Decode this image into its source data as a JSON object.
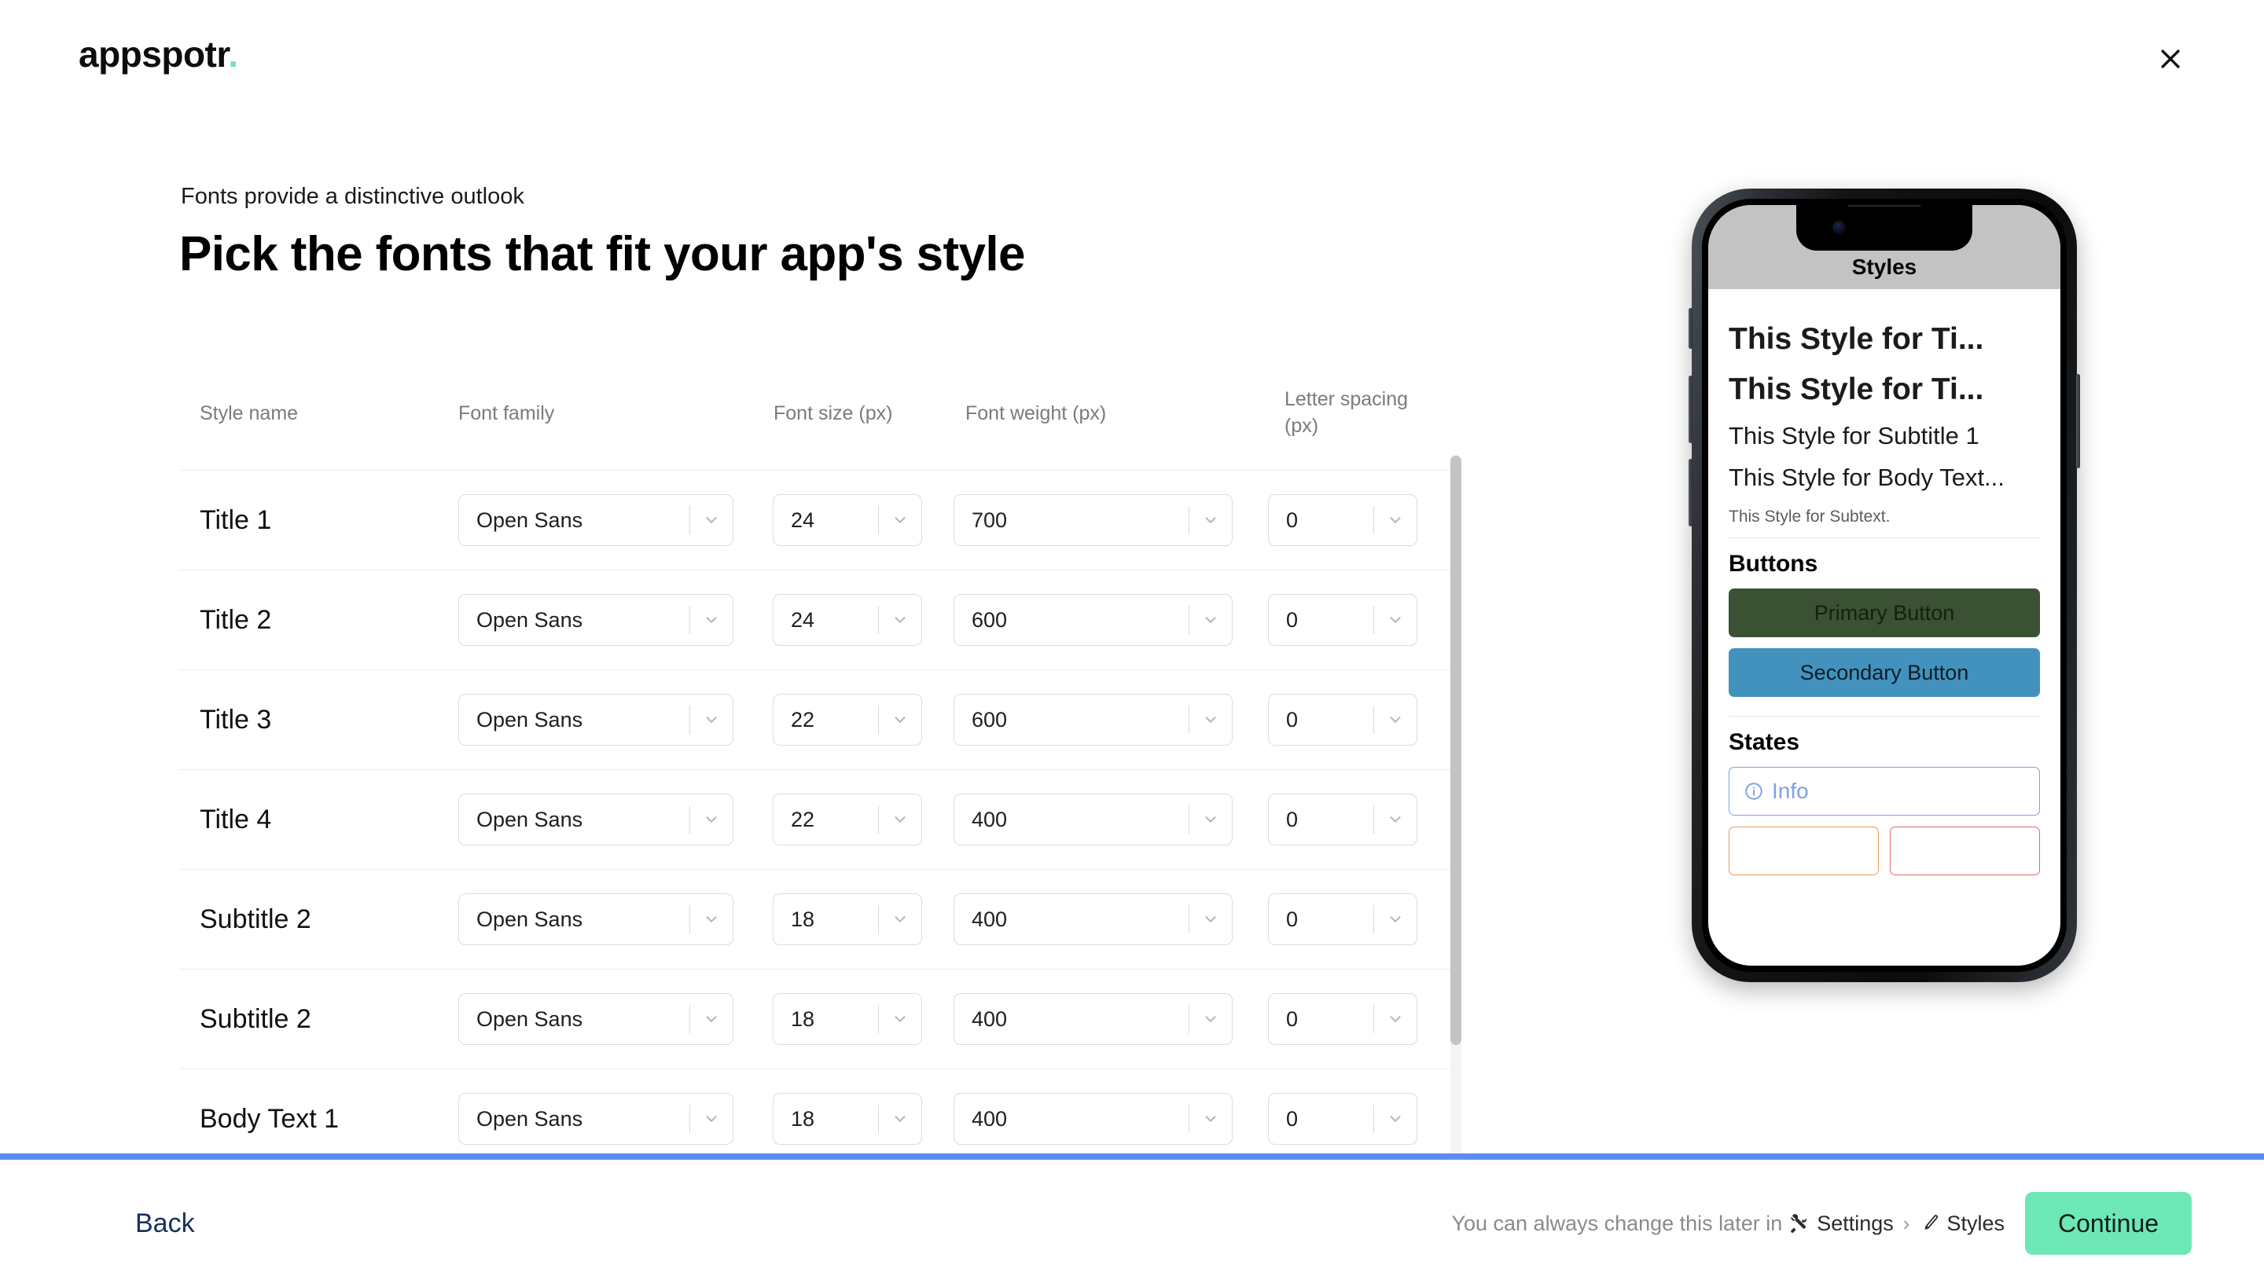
{
  "brand": {
    "name": "appspotr",
    "dot": "."
  },
  "topbar": {
    "close_icon": "close-icon"
  },
  "header": {
    "eyebrow": "Fonts provide a distinctive outlook",
    "title": "Pick the fonts that fit your app's style"
  },
  "table": {
    "columns": [
      "Style name",
      "Font family",
      "Font size (px)",
      "Font weight (px)",
      "Letter spacing (px)"
    ],
    "rows": [
      {
        "style": "Title 1",
        "family": "Open Sans",
        "size": "24",
        "weight": "700",
        "spacing": "0"
      },
      {
        "style": "Title 2",
        "family": "Open Sans",
        "size": "24",
        "weight": "600",
        "spacing": "0"
      },
      {
        "style": "Title 3",
        "family": "Open Sans",
        "size": "22",
        "weight": "600",
        "spacing": "0"
      },
      {
        "style": "Title 4",
        "family": "Open Sans",
        "size": "22",
        "weight": "400",
        "spacing": "0"
      },
      {
        "style": "Subtitle 2",
        "family": "Open Sans",
        "size": "18",
        "weight": "400",
        "spacing": "0"
      },
      {
        "style": "Subtitle 2",
        "family": "Open Sans",
        "size": "18",
        "weight": "400",
        "spacing": "0"
      },
      {
        "style": "Body Text 1",
        "family": "Open Sans",
        "size": "18",
        "weight": "400",
        "spacing": "0"
      }
    ]
  },
  "preview": {
    "app_title": "Styles",
    "title_1": "This Style for Ti...",
    "title_2": "This Style for Ti...",
    "subtitle_1": "This Style for Subtitle 1",
    "body_text": "This Style for Body Text...",
    "subtext": "This Style for Subtext.",
    "buttons_heading": "Buttons",
    "primary_button": "Primary Button",
    "secondary_button": "Secondary Button",
    "states_heading": "States",
    "info_label": "Info",
    "info_icon": "info-circle-icon",
    "colors": {
      "primary": "#3a5134",
      "secondary": "#4292bd",
      "info": "#7e9fe8",
      "warning": "#e59b5a",
      "error": "#dc6a6a",
      "app_header": "#c3c3c3"
    }
  },
  "footer": {
    "back": "Back",
    "note_prefix": "You can always change this later in",
    "settings_label": "Settings",
    "settings_icon": "tools-icon",
    "separator": "›",
    "styles_label": "Styles",
    "styles_icon": "paintbrush-icon",
    "continue": "Continue",
    "accent": "#6EE7B7",
    "progress_color": "#5b8def"
  }
}
